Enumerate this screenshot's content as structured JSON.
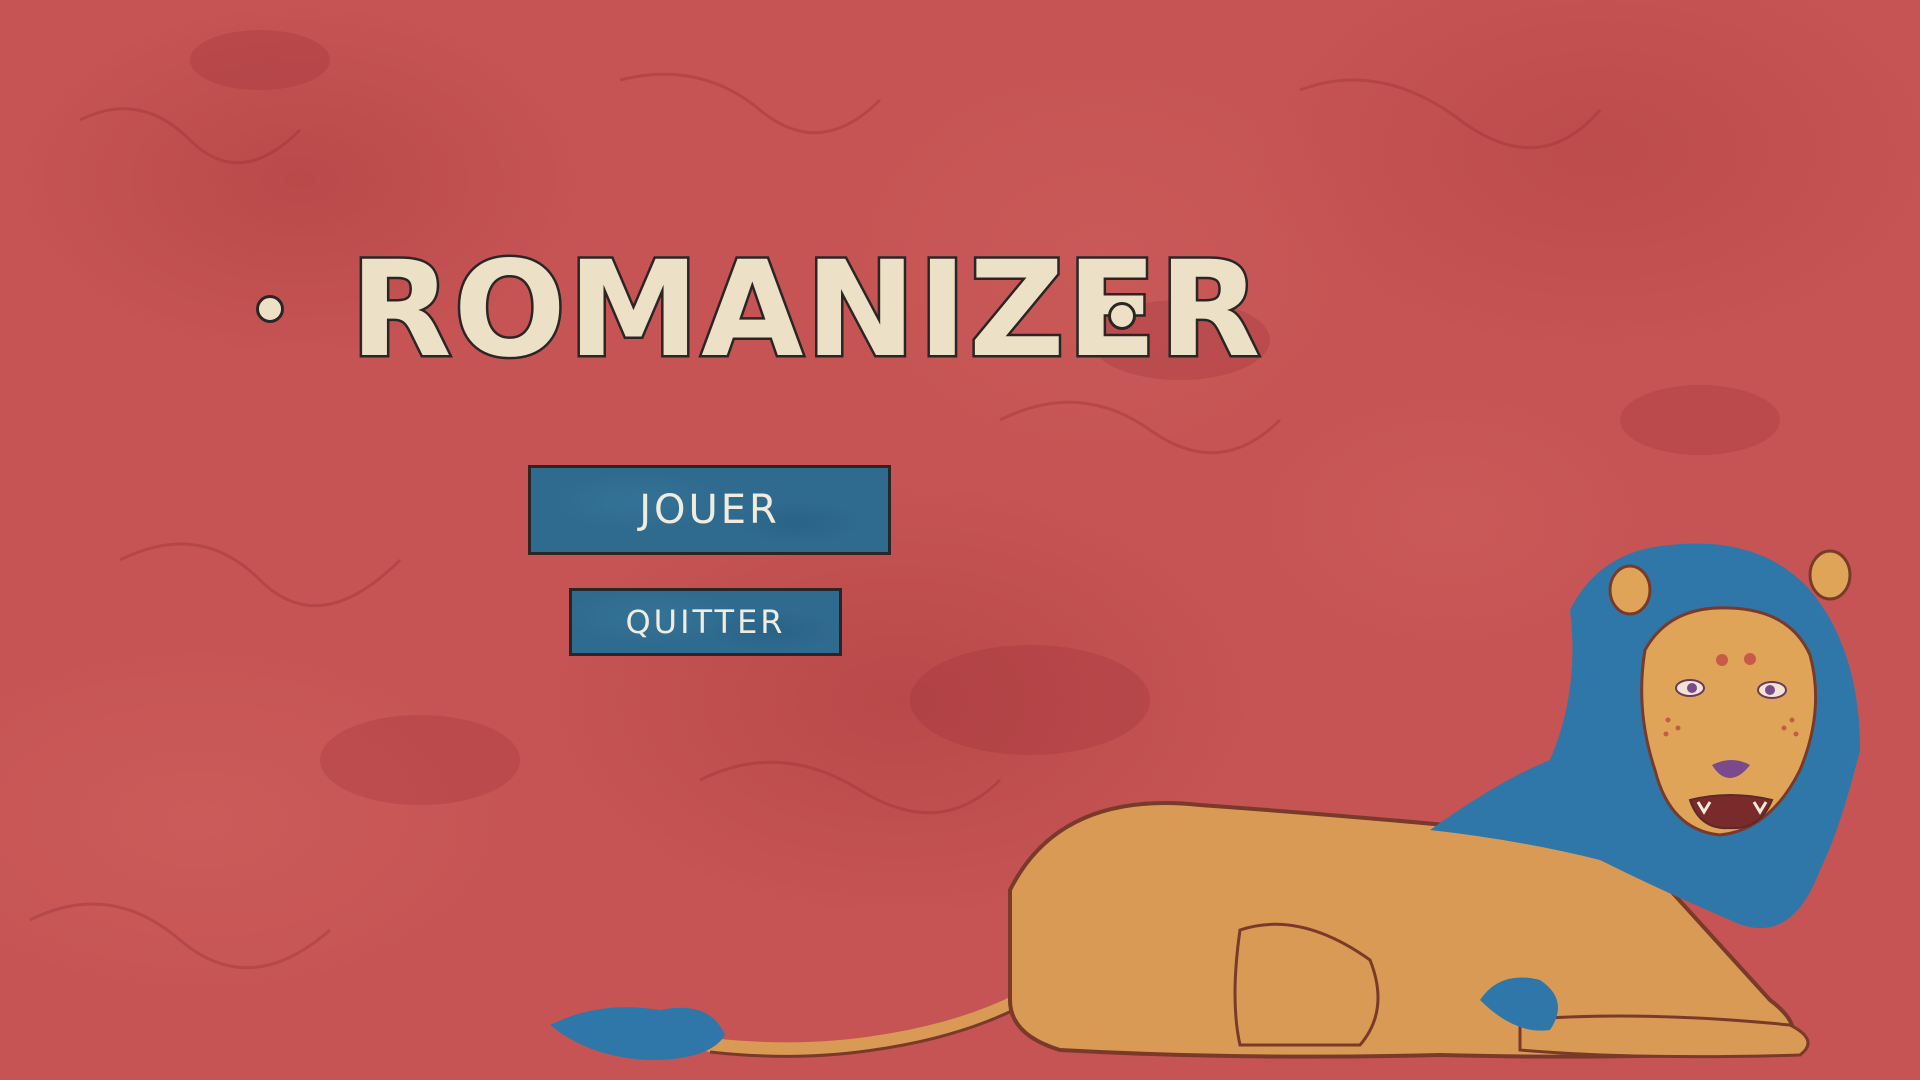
{
  "game": {
    "title": "ROMANIZER"
  },
  "menu": {
    "play_label": "JOUER",
    "quit_label": "QUITTER"
  },
  "colors": {
    "background": "#c65454",
    "button": "#2f6b8f",
    "title_fill": "#ece1c6",
    "outline": "#2a2626",
    "lion_body": "#d99a56",
    "lion_mane": "#2f77a8"
  }
}
